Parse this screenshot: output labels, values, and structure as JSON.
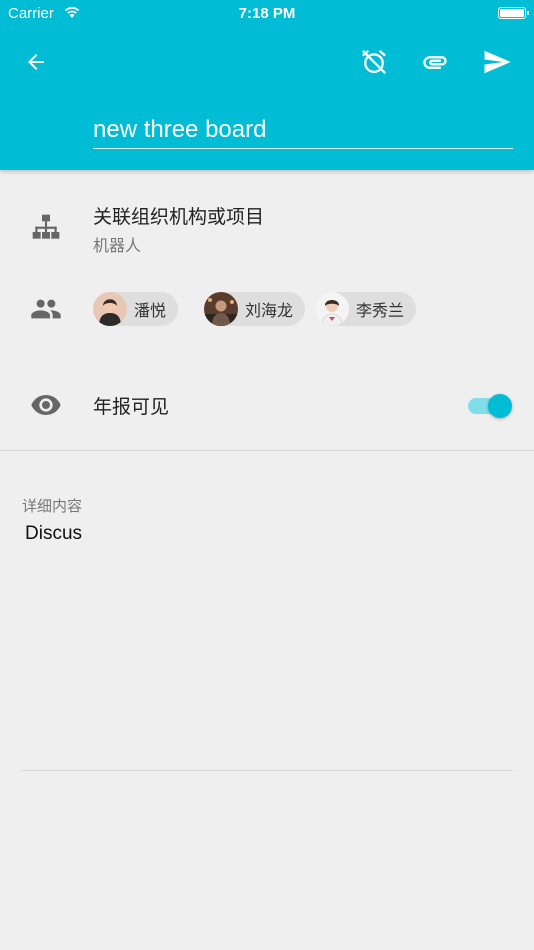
{
  "status_bar": {
    "carrier": "Carrier",
    "time": "7:18 PM"
  },
  "toolbar": {
    "back_icon": "arrow-back-icon",
    "alarm_icon": "alarm-off-icon",
    "attach_icon": "paperclip-icon",
    "send_icon": "send-icon"
  },
  "title_field": {
    "value": "new three board"
  },
  "organization": {
    "title": "关联组织机构或项目",
    "subtitle": "机器人",
    "icon": "sitemap-icon"
  },
  "participants": {
    "icon": "people-icon",
    "items": [
      {
        "name": "潘悦"
      },
      {
        "name": "刘海龙"
      },
      {
        "name": "李秀兰"
      }
    ]
  },
  "annual_report": {
    "label": "年报可见",
    "icon": "eye-icon",
    "enabled": true
  },
  "detail": {
    "label": "详细内容",
    "value": "Discus"
  },
  "colors": {
    "primary": "#00bcd4",
    "toggle_track": "#80deea",
    "background": "#efefef"
  }
}
